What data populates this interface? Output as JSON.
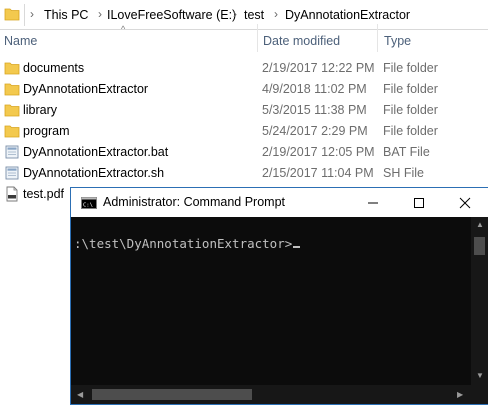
{
  "breadcrumb": {
    "items": [
      "This PC",
      "ILoveFreeSoftware (E:)",
      "test",
      "DyAnnotationExtractor"
    ]
  },
  "columns": {
    "name": "Name",
    "date": "Date modified",
    "type": "Type"
  },
  "files": [
    {
      "name": "documents",
      "date": "2/19/2017 12:22 PM",
      "type": "File folder",
      "icon": "folder-icon"
    },
    {
      "name": "DyAnnotationExtractor",
      "date": "4/9/2018 11:02 PM",
      "type": "File folder",
      "icon": "folder-icon"
    },
    {
      "name": "library",
      "date": "5/3/2015 11:38 PM",
      "type": "File folder",
      "icon": "folder-icon"
    },
    {
      "name": "program",
      "date": "5/24/2017 2:29 PM",
      "type": "File folder",
      "icon": "folder-icon"
    },
    {
      "name": "DyAnnotationExtractor.bat",
      "date": "2/19/2017 12:05 PM",
      "type": "BAT File",
      "icon": "bat-file-icon"
    },
    {
      "name": "DyAnnotationExtractor.sh",
      "date": "2/15/2017 11:04 PM",
      "type": "SH File",
      "icon": "sh-file-icon"
    },
    {
      "name": "test.pdf",
      "date": "",
      "type": "",
      "icon": "pdf-file-icon"
    }
  ],
  "cmd": {
    "title": "Administrator: Command Prompt",
    "prompt": ":\\test\\DyAnnotationExtractor>"
  },
  "colors": {
    "folder": "#f3c94e",
    "header_text": "#4c607a",
    "window_border": "#2c6fb4"
  }
}
